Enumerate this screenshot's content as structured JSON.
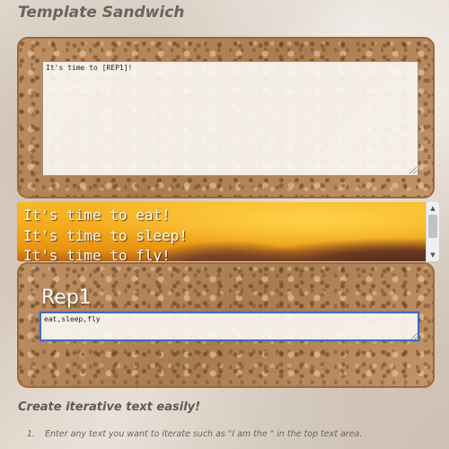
{
  "app": {
    "title": "Template Sandwich"
  },
  "template": {
    "value": "It's time to [REP1]!"
  },
  "output": {
    "lines": [
      "It's time to eat!",
      "It's time to sleep!",
      "It's time to fly!"
    ]
  },
  "replacement": {
    "label": "Rep1",
    "value": "eat,sleep,fly"
  },
  "help": {
    "heading": "Create iterative text easily!",
    "items": [
      {
        "number": "1.",
        "text": "Enter any text you want to iterate such as \"I am the \" in the top text area."
      }
    ]
  },
  "icons": {
    "scroll_up": "chevron-up-icon",
    "scroll_down": "chevron-down-icon",
    "resize": "resize-grip-icon"
  },
  "colors": {
    "title": "#6a6561",
    "bread_border": "#9a6a3d",
    "cheese": "#f4a91b",
    "focus_border": "#4169c9"
  }
}
